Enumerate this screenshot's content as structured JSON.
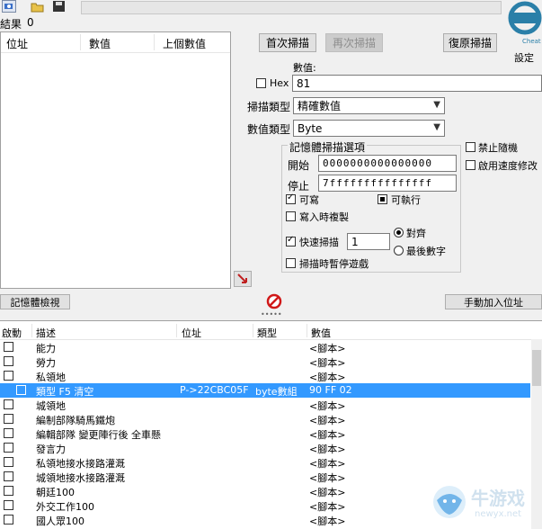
{
  "toolbar": {
    "icons": [
      "process-icon",
      "open-icon",
      "save-icon"
    ]
  },
  "results": {
    "label": "結果",
    "count": "0"
  },
  "found_list": {
    "col_address": "位址",
    "col_value": "數值",
    "col_prev": "上個數值"
  },
  "scan": {
    "first_scan": "首次掃描",
    "next_scan": "再次掃描",
    "undo_scan": "復原掃描",
    "settings": "設定",
    "value_label": "數值:",
    "hex_label": "Hex",
    "value_input": "81",
    "scan_type_label": "掃描類型",
    "scan_type_value": "精確數值",
    "value_type_label": "數值類型",
    "value_type_value": "Byte"
  },
  "mem_options": {
    "title": "記憶體掃描選項",
    "start_label": "開始",
    "start_value": "0000000000000000",
    "stop_label": "停止",
    "stop_value": "7fffffffffffffff",
    "writable": "可寫",
    "executable": "可執行",
    "copy_on_write": "寫入時複製",
    "fast_scan": "快速掃描",
    "fast_scan_value": "1",
    "alignment": "對齊",
    "last_digits": "最後數字",
    "pause_game": "掃描時暫停遊戲"
  },
  "side_options": {
    "no_random": "禁止隨機",
    "speedhack": "啟用速度修改"
  },
  "bottom_bar": {
    "memory_view": "記憶體檢視",
    "add_manual": "手動加入位址"
  },
  "table": {
    "headers": {
      "active": "啟動",
      "description": "描述",
      "address": "位址",
      "type": "類型",
      "value": "數值"
    },
    "rows": [
      {
        "desc": "能力",
        "addr": "",
        "type": "",
        "val": "<腳本>"
      },
      {
        "desc": "勞力",
        "addr": "",
        "type": "",
        "val": "<腳本>"
      },
      {
        "desc": "私領地",
        "addr": "",
        "type": "",
        "val": "<腳本>"
      },
      {
        "desc": "類型 F5 清空",
        "addr": "P->22CBC05F",
        "type": "byte數組",
        "val": "90 FF 02"
      },
      {
        "desc": "城領地",
        "addr": "",
        "type": "",
        "val": "<腳本>"
      },
      {
        "desc": "編制部隊騎馬鐵炮",
        "addr": "",
        "type": "",
        "val": "<腳本>"
      },
      {
        "desc": "編輯部隊 變更陣行後 全車懸",
        "addr": "",
        "type": "",
        "val": "<腳本>"
      },
      {
        "desc": "發言力",
        "addr": "",
        "type": "",
        "val": "<腳本>"
      },
      {
        "desc": "私領地接水接路灌溉",
        "addr": "",
        "type": "",
        "val": "<腳本>"
      },
      {
        "desc": "城領地接水接路灌溉",
        "addr": "",
        "type": "",
        "val": "<腳本>"
      },
      {
        "desc": "朝廷100",
        "addr": "",
        "type": "",
        "val": "<腳本>"
      },
      {
        "desc": "外交工作100",
        "addr": "",
        "type": "",
        "val": "<腳本>"
      },
      {
        "desc": "國人眾100",
        "addr": "",
        "type": "",
        "val": "<腳本>"
      }
    ]
  },
  "watermark": {
    "text": "牛游戏",
    "sub": "newyx.net"
  }
}
